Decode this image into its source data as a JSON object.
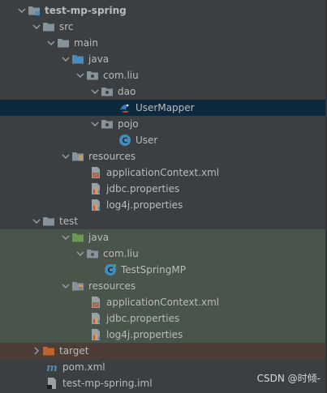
{
  "colors": {
    "background": "#3c3f41",
    "selected_row": "#0d293e",
    "test_zone": "#49544a",
    "excluded_zone": "#4c3e37",
    "text": "#bbbbbb",
    "folder_gray": "#87939a",
    "folder_blue": "#4f8ab8",
    "folder_green": "#6a9955",
    "folder_orange": "#c0642c",
    "class_blue": "#3f8fbf"
  },
  "tree": {
    "project": "test-mp-spring",
    "src": "src",
    "main": "main",
    "java_main": "java",
    "pkg_main": "com.liu",
    "dao": "dao",
    "user_mapper": "UserMapper",
    "pojo": "pojo",
    "user": "User",
    "resources_main": "resources",
    "app_ctx_main": "applicationContext.xml",
    "jdbc_main": "jdbc.properties",
    "log4j_main": "log4j.properties",
    "test": "test",
    "java_test": "java",
    "pkg_test": "com.liu",
    "test_class": "TestSpringMP",
    "resources_test": "resources",
    "app_ctx_test": "applicationContext.xml",
    "jdbc_test": "jdbc.properties",
    "log4j_test": "log4j.properties",
    "target": "target",
    "pom": "pom.xml",
    "iml": "test-mp-spring.iml"
  },
  "watermark": "CSDN @时倾-"
}
